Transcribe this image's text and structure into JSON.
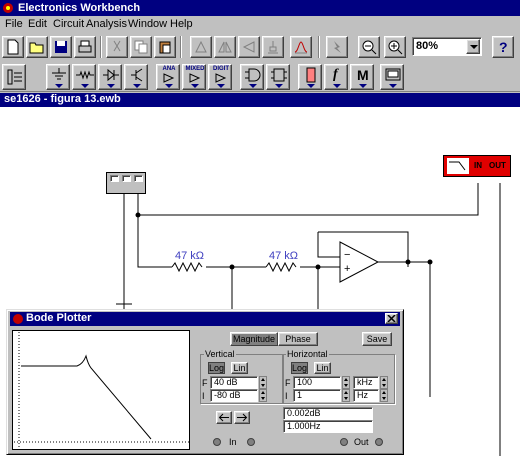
{
  "app": {
    "title": "Electronics Workbench"
  },
  "menu": [
    "File",
    "Edit",
    "Circuit",
    "Analysis",
    "Window",
    "Help"
  ],
  "toolbar": {
    "zoom_value": "80%",
    "help_label": "?"
  },
  "parts_bin": {
    "ana": "ANA",
    "mixed": "MIXED",
    "digit": "DIGIT",
    "f_label": "f",
    "m_label": "M"
  },
  "document": {
    "title": "se1626 - figura 13.ewb"
  },
  "circuit": {
    "r1_label": "47 kΩ",
    "r2_label": "47 kΩ",
    "minus": "−",
    "plus": "+",
    "bode_in": "IN",
    "bode_out": "OUT"
  },
  "bode": {
    "title": "Bode Plotter",
    "magnitude_label": "Magnitude",
    "phase_label": "Phase",
    "save_label": "Save",
    "vertical_label": "Vertical",
    "horizontal_label": "Horizontal",
    "log_label": "Log",
    "lin_label": "Lin",
    "v_f_prefix": "F",
    "v_i_prefix": "I",
    "v_f_value": "40 dB",
    "v_i_value": "-80 dB",
    "h_f_prefix": "F",
    "h_i_prefix": "I",
    "h_f_value": "100",
    "h_i_value": "1",
    "h_f_unit": "kHz",
    "h_i_unit": "Hz",
    "readout_db": "0.002dB",
    "readout_freq": "1.000Hz",
    "in_label": "In",
    "out_label": "Out"
  }
}
